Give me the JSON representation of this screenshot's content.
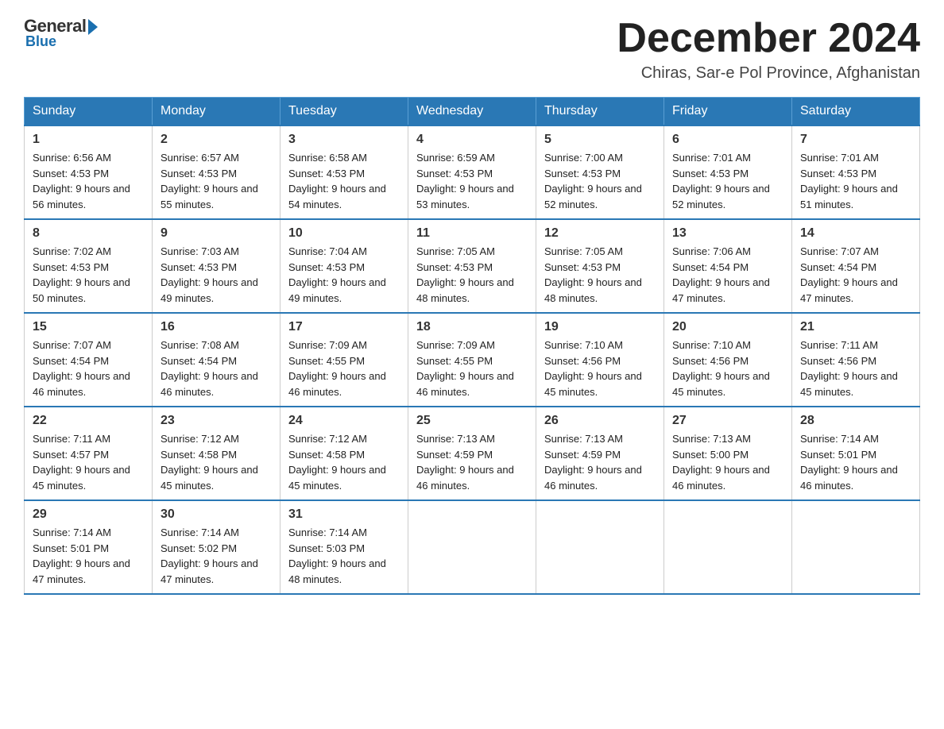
{
  "header": {
    "logo": {
      "general": "General",
      "blue": "Blue",
      "bottom": "Blue"
    },
    "title": "December 2024",
    "location": "Chiras, Sar-e Pol Province, Afghanistan"
  },
  "weekdays": [
    "Sunday",
    "Monday",
    "Tuesday",
    "Wednesday",
    "Thursday",
    "Friday",
    "Saturday"
  ],
  "weeks": [
    [
      {
        "day": "1",
        "sunrise": "6:56 AM",
        "sunset": "4:53 PM",
        "daylight": "9 hours and 56 minutes."
      },
      {
        "day": "2",
        "sunrise": "6:57 AM",
        "sunset": "4:53 PM",
        "daylight": "9 hours and 55 minutes."
      },
      {
        "day": "3",
        "sunrise": "6:58 AM",
        "sunset": "4:53 PM",
        "daylight": "9 hours and 54 minutes."
      },
      {
        "day": "4",
        "sunrise": "6:59 AM",
        "sunset": "4:53 PM",
        "daylight": "9 hours and 53 minutes."
      },
      {
        "day": "5",
        "sunrise": "7:00 AM",
        "sunset": "4:53 PM",
        "daylight": "9 hours and 52 minutes."
      },
      {
        "day": "6",
        "sunrise": "7:01 AM",
        "sunset": "4:53 PM",
        "daylight": "9 hours and 52 minutes."
      },
      {
        "day": "7",
        "sunrise": "7:01 AM",
        "sunset": "4:53 PM",
        "daylight": "9 hours and 51 minutes."
      }
    ],
    [
      {
        "day": "8",
        "sunrise": "7:02 AM",
        "sunset": "4:53 PM",
        "daylight": "9 hours and 50 minutes."
      },
      {
        "day": "9",
        "sunrise": "7:03 AM",
        "sunset": "4:53 PM",
        "daylight": "9 hours and 49 minutes."
      },
      {
        "day": "10",
        "sunrise": "7:04 AM",
        "sunset": "4:53 PM",
        "daylight": "9 hours and 49 minutes."
      },
      {
        "day": "11",
        "sunrise": "7:05 AM",
        "sunset": "4:53 PM",
        "daylight": "9 hours and 48 minutes."
      },
      {
        "day": "12",
        "sunrise": "7:05 AM",
        "sunset": "4:53 PM",
        "daylight": "9 hours and 48 minutes."
      },
      {
        "day": "13",
        "sunrise": "7:06 AM",
        "sunset": "4:54 PM",
        "daylight": "9 hours and 47 minutes."
      },
      {
        "day": "14",
        "sunrise": "7:07 AM",
        "sunset": "4:54 PM",
        "daylight": "9 hours and 47 minutes."
      }
    ],
    [
      {
        "day": "15",
        "sunrise": "7:07 AM",
        "sunset": "4:54 PM",
        "daylight": "9 hours and 46 minutes."
      },
      {
        "day": "16",
        "sunrise": "7:08 AM",
        "sunset": "4:54 PM",
        "daylight": "9 hours and 46 minutes."
      },
      {
        "day": "17",
        "sunrise": "7:09 AM",
        "sunset": "4:55 PM",
        "daylight": "9 hours and 46 minutes."
      },
      {
        "day": "18",
        "sunrise": "7:09 AM",
        "sunset": "4:55 PM",
        "daylight": "9 hours and 46 minutes."
      },
      {
        "day": "19",
        "sunrise": "7:10 AM",
        "sunset": "4:56 PM",
        "daylight": "9 hours and 45 minutes."
      },
      {
        "day": "20",
        "sunrise": "7:10 AM",
        "sunset": "4:56 PM",
        "daylight": "9 hours and 45 minutes."
      },
      {
        "day": "21",
        "sunrise": "7:11 AM",
        "sunset": "4:56 PM",
        "daylight": "9 hours and 45 minutes."
      }
    ],
    [
      {
        "day": "22",
        "sunrise": "7:11 AM",
        "sunset": "4:57 PM",
        "daylight": "9 hours and 45 minutes."
      },
      {
        "day": "23",
        "sunrise": "7:12 AM",
        "sunset": "4:58 PM",
        "daylight": "9 hours and 45 minutes."
      },
      {
        "day": "24",
        "sunrise": "7:12 AM",
        "sunset": "4:58 PM",
        "daylight": "9 hours and 45 minutes."
      },
      {
        "day": "25",
        "sunrise": "7:13 AM",
        "sunset": "4:59 PM",
        "daylight": "9 hours and 46 minutes."
      },
      {
        "day": "26",
        "sunrise": "7:13 AM",
        "sunset": "4:59 PM",
        "daylight": "9 hours and 46 minutes."
      },
      {
        "day": "27",
        "sunrise": "7:13 AM",
        "sunset": "5:00 PM",
        "daylight": "9 hours and 46 minutes."
      },
      {
        "day": "28",
        "sunrise": "7:14 AM",
        "sunset": "5:01 PM",
        "daylight": "9 hours and 46 minutes."
      }
    ],
    [
      {
        "day": "29",
        "sunrise": "7:14 AM",
        "sunset": "5:01 PM",
        "daylight": "9 hours and 47 minutes."
      },
      {
        "day": "30",
        "sunrise": "7:14 AM",
        "sunset": "5:02 PM",
        "daylight": "9 hours and 47 minutes."
      },
      {
        "day": "31",
        "sunrise": "7:14 AM",
        "sunset": "5:03 PM",
        "daylight": "9 hours and 48 minutes."
      },
      null,
      null,
      null,
      null
    ]
  ]
}
